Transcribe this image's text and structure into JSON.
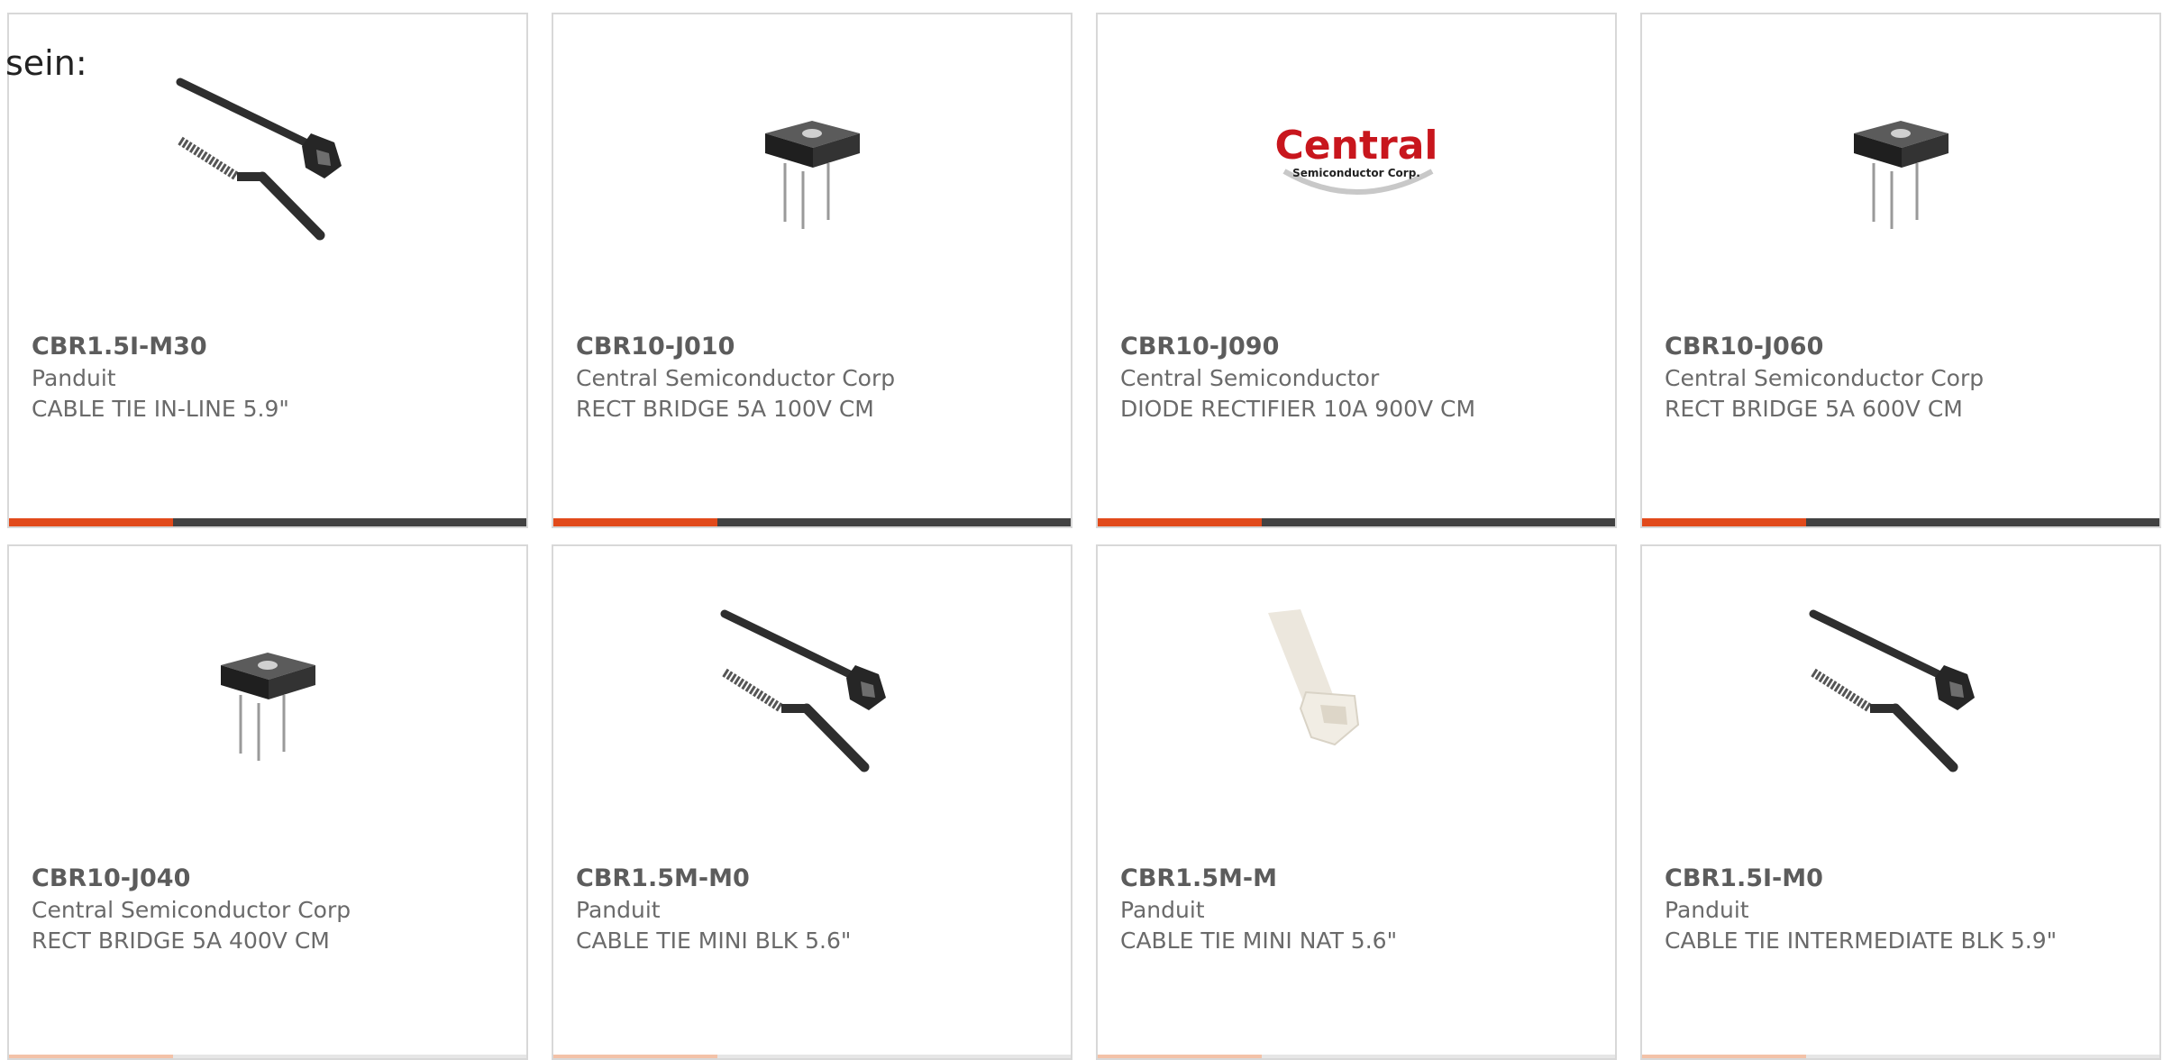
{
  "lead_text": "sein:",
  "colors": {
    "accent": "#e14a1b",
    "bar_dark": "#424242",
    "border": "#d8d8d8",
    "text": "#666666"
  },
  "products": [
    {
      "part": "CBR1.5I-M30",
      "manufacturer": "Panduit",
      "description": "CABLE TIE IN-LINE 5.9\"",
      "image": "cable-tie-black-image"
    },
    {
      "part": "CBR10-J010",
      "manufacturer": "Central Semiconductor Corp",
      "description": "RECT BRIDGE 5A 100V CM",
      "image": "bridge-rectifier-image"
    },
    {
      "part": "CBR10-J090",
      "manufacturer": "Central Semiconductor",
      "description": "DIODE RECTIFIER 10A 900V CM",
      "image": "central-semiconductor-logo",
      "logo_text": "Central",
      "logo_subtext": "Semiconductor Corp."
    },
    {
      "part": "CBR10-J060",
      "manufacturer": "Central Semiconductor Corp",
      "description": "RECT BRIDGE 5A 600V CM",
      "image": "bridge-rectifier-image"
    },
    {
      "part": "CBR10-J040",
      "manufacturer": "Central Semiconductor Corp",
      "description": "RECT BRIDGE 5A 400V CM",
      "image": "bridge-rectifier-image"
    },
    {
      "part": "CBR1.5M-M0",
      "manufacturer": "Panduit",
      "description": "CABLE TIE MINI BLK 5.6\"",
      "image": "cable-tie-black-image"
    },
    {
      "part": "CBR1.5M-M",
      "manufacturer": "Panduit",
      "description": "CABLE TIE MINI NAT 5.6\"",
      "image": "cable-tie-natural-image"
    },
    {
      "part": "CBR1.5I-M0",
      "manufacturer": "Panduit",
      "description": "CABLE TIE INTERMEDIATE BLK 5.9\"",
      "image": "cable-tie-black-image"
    }
  ]
}
